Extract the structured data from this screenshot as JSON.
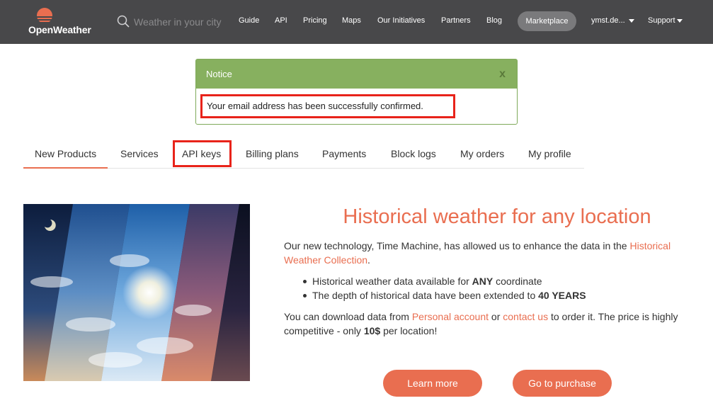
{
  "header": {
    "logo_text": "OpenWeather",
    "search_placeholder": "Weather in your city",
    "nav": [
      "Guide",
      "API",
      "Pricing",
      "Maps",
      "Our Initiatives",
      "Partners",
      "Blog"
    ],
    "marketplace_label": "Marketplace",
    "user_label": "ymst.de...",
    "support_label": "Support"
  },
  "notice": {
    "title": "Notice",
    "close_label": "x",
    "message": "Your email address has been successfully confirmed."
  },
  "tabs": [
    "New Products",
    "Services",
    "API keys",
    "Billing plans",
    "Payments",
    "Block logs",
    "My orders",
    "My profile"
  ],
  "active_tab": "New Products",
  "highlighted_tab": "API keys",
  "content": {
    "title": "Historical weather for any location",
    "p1_start": "Our new technology, Time Machine, has allowed us to enhance the data in the ",
    "p1_link": "Historical Weather Collection",
    "p1_end": ".",
    "bullet1_start": "Historical weather data available for ",
    "bullet1_bold": "ANY",
    "bullet1_end": " coordinate",
    "bullet2_start": "The depth of historical data have been extended to ",
    "bullet2_bold": "40 YEARS",
    "p2_start": "You can download data from ",
    "p2_link1": "Personal account",
    "p2_mid": " or ",
    "p2_link2": "contact us",
    "p2_mid2": " to order it. The price is highly competitive - only ",
    "p2_bold": "10$",
    "p2_end": " per location!",
    "btn_learn": "Learn more",
    "btn_purchase": "Go to purchase"
  },
  "colors": {
    "header_bg": "#48484a",
    "accent": "#e96e50",
    "notice_green": "#87b05f",
    "highlight_red": "#e8231a"
  }
}
